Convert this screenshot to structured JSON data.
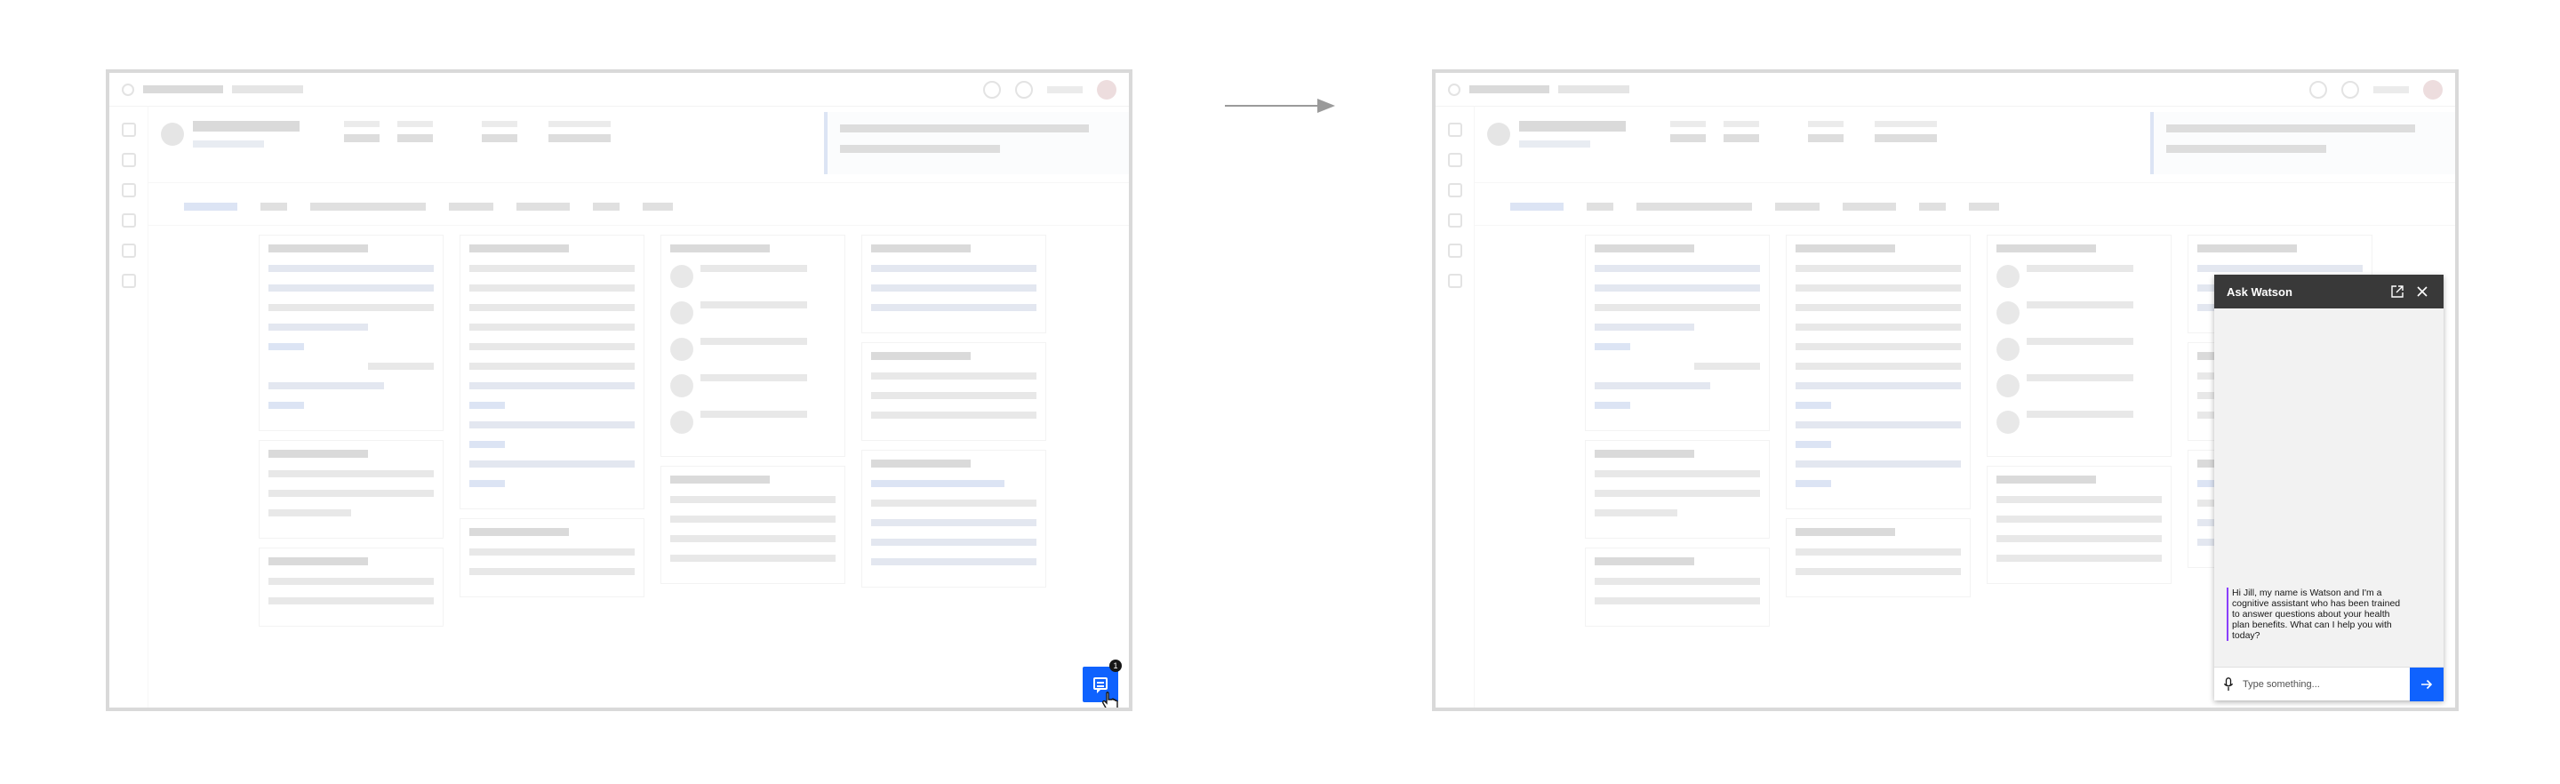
{
  "chat_widget": {
    "badge_count": "1"
  },
  "watson_panel": {
    "title": "Ask Watson",
    "greeting": "Hi Jill, my name is Watson and I'm a cognitive assistant who has been trained to answer questions about your health plan benefits. What can I help you with today?",
    "input_placeholder": "Type something..."
  },
  "icons": {
    "transition": "arrow-right-icon",
    "open": "chat-icon",
    "pointer": "hand-cursor-icon",
    "popout": "popout-icon",
    "close": "close-icon",
    "mic": "microphone-icon",
    "send": "send-arrow-icon"
  },
  "colors": {
    "primary": "#0f62fe",
    "panel_header": "#393939",
    "panel_body": "#f2f2f2",
    "message_accent": "#8a3ffc"
  }
}
